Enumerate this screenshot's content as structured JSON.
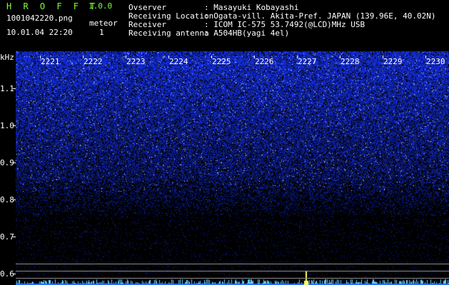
{
  "header": {
    "app_name": "H R O F F T",
    "version": "1.0.0",
    "filename": "1001042220.png",
    "meteor_label": "meteor",
    "meteor_count": "1",
    "datetime": "10.01.04 22:20",
    "info": [
      {
        "label": "Ovserver",
        "value": ": Masayuki Kobayashi"
      },
      {
        "label": "Receiving Location",
        "value": ": Ogata-vill. Akita-Pref. JAPAN (139.96E, 40.02N)"
      },
      {
        "label": "Receiver",
        "value": ": ICOM IC-575 53.7492(@LCD)MHz USB"
      },
      {
        "label": "Receiving antenna",
        "value": ": A504HB(yagi 4el)"
      }
    ]
  },
  "colors": {
    "background": "#000000",
    "signal": "#1a3cff",
    "signal_bright": "#b8c4ff",
    "meteor_trace": "#ffff60",
    "app_name": "#7fff3a",
    "text": "#ffffff"
  },
  "chart_data": {
    "type": "heatmap",
    "ylabel": "kHz",
    "y_ticks": [
      "1.1",
      "1.0",
      "0.9",
      "0.8",
      "0.7",
      "0.6"
    ],
    "ylim": [
      0.57,
      1.2
    ],
    "x_ticks": [
      "2221",
      "2222",
      "2223",
      "2224",
      "2225",
      "2226",
      "2227",
      "2228",
      "2229",
      "2230"
    ],
    "meteor_events": [
      {
        "time": "2227.2"
      }
    ]
  }
}
